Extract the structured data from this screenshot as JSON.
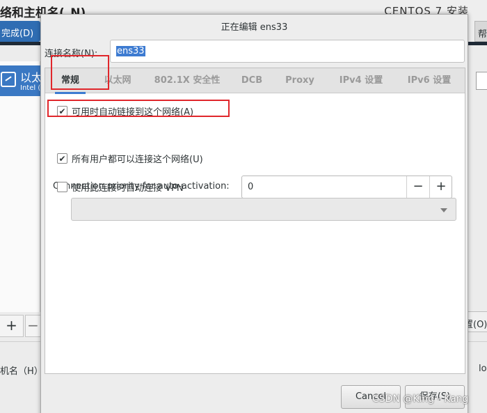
{
  "background": {
    "title": "络和主机名(_N)",
    "product": "CENTOS 7 安装",
    "done_button": "完成(D)",
    "help_button": "帮",
    "list_item_name": "以太",
    "list_item_sub": "Intel (",
    "plus": "+",
    "minus": "−",
    "configure_button": "置(O)",
    "hostname_label": "机名（H）",
    "lo_text": "lo"
  },
  "dialog": {
    "title": "正在编辑 ens33",
    "connection_name_label": "连接名称(N):",
    "connection_name_value": "ens33",
    "tabs": [
      {
        "label": "常规",
        "active": true
      },
      {
        "label": "以太网",
        "active": false
      },
      {
        "label": "802.1X 安全性",
        "active": false
      },
      {
        "label": "DCB",
        "active": false
      },
      {
        "label": "Proxy",
        "active": false
      },
      {
        "label": "IPv4 设置",
        "active": false
      },
      {
        "label": "IPv6 设置",
        "active": false
      }
    ],
    "auto_connect": {
      "label": "可用时自动链接到这个网络(A)",
      "checked": true,
      "mark": "✔"
    },
    "priority_label": "Connection priority for auto-activation:",
    "priority_value": "0",
    "minus": "−",
    "plus": "+",
    "all_users": {
      "label": "所有用户都可以连接这个网络(U)",
      "checked": true,
      "mark": "✔"
    },
    "vpn_auto": {
      "label": "使用此连接时自动连接 VPN",
      "checked": false
    },
    "vpn_select_value": "",
    "cancel_button": "Cancel",
    "save_button": "保存(S)"
  },
  "annotation_color": "#e0262b",
  "accent_color": "#3d7bd1",
  "watermark": "CSDN @King - Kang"
}
